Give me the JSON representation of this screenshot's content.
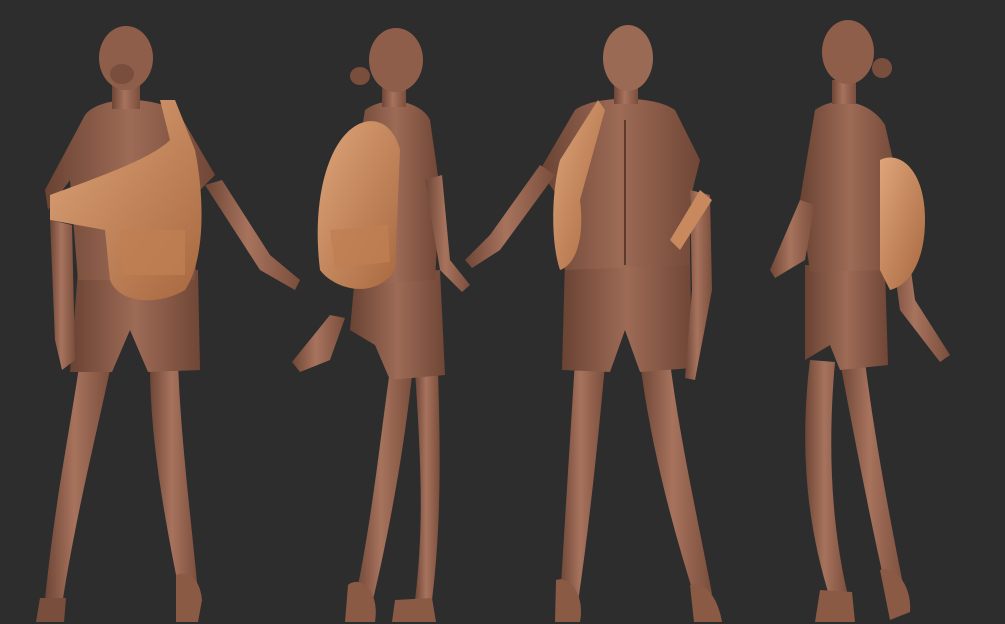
{
  "scene": {
    "background_color": "#2d2d2d",
    "clay_color": "#9a6a55",
    "clay_shadow_color": "#6e4636",
    "clay_highlight_color": "#b98670",
    "bag_color": "#c8895e",
    "bag_highlight_color": "#dfa57a",
    "figures": [
      {
        "view": "back"
      },
      {
        "view": "side-left"
      },
      {
        "view": "front"
      },
      {
        "view": "side-right"
      }
    ]
  }
}
